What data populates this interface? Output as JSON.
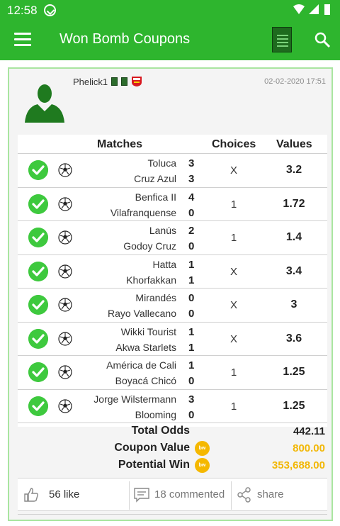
{
  "status_bar": {
    "time": "12:58"
  },
  "app_bar": {
    "title": "Won Bomb Coupons"
  },
  "post": {
    "username": "Phelick1",
    "date": "02-02-2020 17:51"
  },
  "table": {
    "headers": {
      "matches": "Matches",
      "choices": "Choices",
      "values": "Values"
    },
    "rows": [
      {
        "home": "Toluca",
        "away": "Cruz Azul",
        "home_score": "3",
        "away_score": "3",
        "choice": "X",
        "value": "3.2"
      },
      {
        "home": "Benfica II",
        "away": "Vilafranquense",
        "home_score": "4",
        "away_score": "0",
        "choice": "1",
        "value": "1.72"
      },
      {
        "home": "Lanús",
        "away": "Godoy Cruz",
        "home_score": "2",
        "away_score": "0",
        "choice": "1",
        "value": "1.4"
      },
      {
        "home": "Hatta",
        "away": "Khorfakkan",
        "home_score": "1",
        "away_score": "1",
        "choice": "X",
        "value": "3.4"
      },
      {
        "home": "Mirandés",
        "away": "Rayo Vallecano",
        "home_score": "0",
        "away_score": "0",
        "choice": "X",
        "value": "3"
      },
      {
        "home": "Wikki Tourist",
        "away": "Akwa Starlets",
        "home_score": "1",
        "away_score": "1",
        "choice": "X",
        "value": "3.6"
      },
      {
        "home": "América de Cali",
        "away": "Boyacá Chicó",
        "home_score": "1",
        "away_score": "0",
        "choice": "1",
        "value": "1.25"
      },
      {
        "home": "Jorge Wilstermann",
        "away": "Blooming",
        "home_score": "3",
        "away_score": "0",
        "choice": "1",
        "value": "1.25"
      }
    ]
  },
  "summary": {
    "total_odds_label": "Total Odds",
    "total_odds": "442.11",
    "coupon_value_label": "Coupon Value",
    "coupon_value": "800.00",
    "potential_win_label": "Potential Win",
    "potential_win": "353,688.00",
    "coin_text": "bw"
  },
  "actions": {
    "likes": "56 like",
    "comments": "18 commented",
    "share": "share"
  },
  "colors": {
    "primary": "#2eb52e",
    "check": "#3ec93e",
    "gold": "#f2b705"
  }
}
